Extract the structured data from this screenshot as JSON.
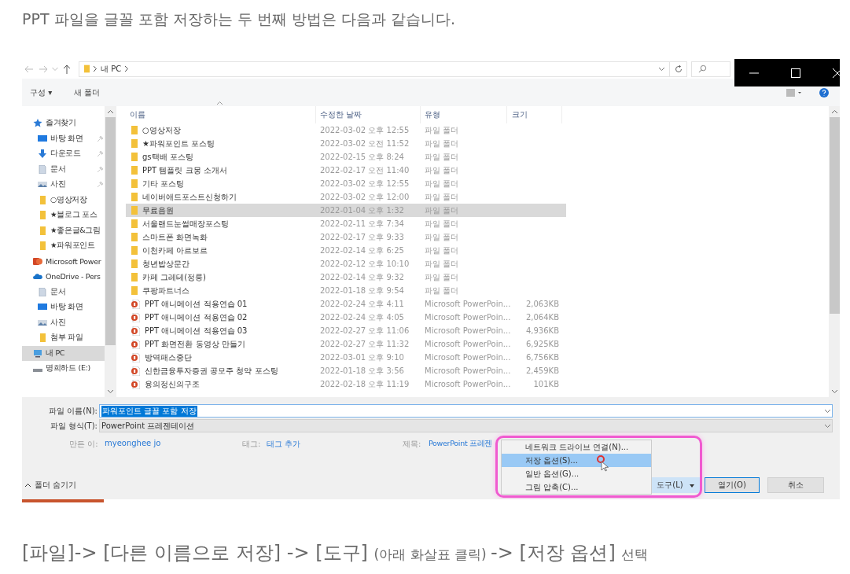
{
  "intro": "PPT 파일을 글꼴 포함 저장하는 두 번째 방법은 다음과 같습니다.",
  "dialog": {
    "path": [
      "내 PC"
    ],
    "toolbar": {
      "organize": "구성 ▾",
      "new_folder": "새 폴더"
    },
    "sidebar": [
      {
        "label": "즐겨찾기",
        "kind": "star",
        "pinned": false,
        "selected": false,
        "children": [
          {
            "label": "바탕 화면",
            "kind": "desktop",
            "pinned": true,
            "selected": false
          },
          {
            "label": "다운로드",
            "kind": "download",
            "pinned": true,
            "selected": false
          },
          {
            "label": "문서",
            "kind": "document",
            "pinned": true,
            "selected": false
          },
          {
            "label": "사진",
            "kind": "image",
            "pinned": true,
            "selected": false
          },
          {
            "label": "○영상저장",
            "kind": "folder",
            "pinned": false,
            "selected": false
          },
          {
            "label": "★블로그 포스",
            "kind": "folder",
            "pinned": false,
            "selected": false
          },
          {
            "label": "★좋은글&그림",
            "kind": "folder",
            "pinned": false,
            "selected": false
          },
          {
            "label": "★파워포인트",
            "kind": "folder",
            "pinned": false,
            "selected": false
          }
        ]
      },
      {
        "label": "Microsoft Power",
        "kind": "app",
        "pinned": false,
        "selected": false
      },
      {
        "label": "OneDrive - Pers",
        "kind": "cloud",
        "pinned": false,
        "selected": false,
        "children": [
          {
            "label": "문서",
            "kind": "document",
            "pinned": false,
            "selected": false
          },
          {
            "label": "바탕 화면",
            "kind": "desktop",
            "pinned": false,
            "selected": false
          },
          {
            "label": "사진",
            "kind": "image",
            "pinned": false,
            "selected": false
          },
          {
            "label": "첨부 파일",
            "kind": "folder",
            "pinned": false,
            "selected": false
          }
        ]
      },
      {
        "label": "내 PC",
        "kind": "pc",
        "pinned": false,
        "selected": true
      },
      {
        "label": "명희하드 (E:)",
        "kind": "drive",
        "pinned": false,
        "selected": false
      }
    ],
    "columns": [
      "이름",
      "수정한 날짜",
      "유형",
      "크기"
    ],
    "files": [
      {
        "name": "○영상저장",
        "kind": "folder",
        "date": "2022-03-02 오후 12:55",
        "type": "파일 폴더",
        "selected": false
      },
      {
        "name": "★파워포인트 포스팅",
        "kind": "folder",
        "date": "2022-03-02 오전 11:52",
        "type": "파일 폴더",
        "selected": false
      },
      {
        "name": "gs택배 포스팅",
        "kind": "folder",
        "date": "2022-02-15 오후 8:24",
        "type": "파일 폴더",
        "selected": false
      },
      {
        "name": "PPT 템플릿 크몽 소개서",
        "kind": "folder",
        "date": "2022-02-17 오전 11:40",
        "type": "파일 폴더",
        "selected": false
      },
      {
        "name": "기타 포스팅",
        "kind": "folder",
        "date": "2022-03-02 오후 12:55",
        "type": "파일 폴더",
        "selected": false
      },
      {
        "name": "네이버애드포스트신청하기",
        "kind": "folder",
        "date": "2022-03-02 오후 12:00",
        "type": "파일 폴더",
        "selected": false
      },
      {
        "name": "무료음원",
        "kind": "folder",
        "date": "2022-01-04 오후 1:32",
        "type": "파일 폴더",
        "selected": true
      },
      {
        "name": "서울랜드눈썰매장포스팅",
        "kind": "folder",
        "date": "2022-02-11 오후 7:34",
        "type": "파일 폴더",
        "selected": false
      },
      {
        "name": "스마트폰 화면녹화",
        "kind": "folder",
        "date": "2022-02-17 오후 9:33",
        "type": "파일 폴더",
        "selected": false
      },
      {
        "name": "이천카페 아르보르",
        "kind": "folder",
        "date": "2022-02-14 오후 6:25",
        "type": "파일 폴더",
        "selected": false
      },
      {
        "name": "청년밥상문간",
        "kind": "folder",
        "date": "2022-02-12 오후 10:10",
        "type": "파일 폴더",
        "selected": false
      },
      {
        "name": "카페 그레테(정릉)",
        "kind": "folder",
        "date": "2022-02-14 오후 9:32",
        "type": "파일 폴더",
        "selected": false
      },
      {
        "name": "쿠팡파트너스",
        "kind": "folder",
        "date": "2022-01-18 오후 9:54",
        "type": "파일 폴더",
        "selected": false
      },
      {
        "name": "PPT 애니메이션 적용연습 01",
        "kind": "ppt",
        "date": "2022-02-24 오후 4:11",
        "type": "Microsoft PowerPoin...",
        "size": "2,063KB",
        "selected": false
      },
      {
        "name": "PPT 애니메이션 적용연습 02",
        "kind": "ppt",
        "date": "2022-02-24 오후 4:05",
        "type": "Microsoft PowerPoin...",
        "size": "2,064KB",
        "selected": false
      },
      {
        "name": "PPT 애니메이션 적용연습 03",
        "kind": "ppt",
        "date": "2022-02-27 오후 11:06",
        "type": "Microsoft PowerPoin...",
        "size": "4,936KB",
        "selected": false
      },
      {
        "name": "PPT 화면전환 동영상 만들기",
        "kind": "ppt",
        "date": "2022-02-27 오후 11:32",
        "type": "Microsoft PowerPoin...",
        "size": "6,925KB",
        "selected": false
      },
      {
        "name": "방역패스중단",
        "kind": "ppt",
        "date": "2022-03-01 오후 9:10",
        "type": "Microsoft PowerPoin...",
        "size": "6,756KB",
        "selected": false
      },
      {
        "name": "신한금융투자증권 공모주 청약 포스팅",
        "kind": "ppt",
        "date": "2022-01-18 오후 3:56",
        "type": "Microsoft PowerPoin...",
        "size": "2,459KB",
        "selected": false
      },
      {
        "name": "융의정신의구조",
        "kind": "ppt",
        "date": "2022-02-18 오후 11:19",
        "type": "Microsoft PowerPoin...",
        "size": "101KB",
        "selected": false
      }
    ],
    "file_name": {
      "label": "파일 이름(N):",
      "value": "파워포인트 글꼴 포함 저장"
    },
    "file_type": {
      "label": "파일 형식(T):",
      "value": "PowerPoint 프레젠테이션"
    },
    "meta": [
      {
        "label": "만든 이:",
        "value": "myeonghee jo"
      },
      {
        "label": "태그:",
        "value": "태그 추가"
      },
      {
        "label": "제목:",
        "value": "PowerPoint 프레젠"
      }
    ],
    "hide_folders": "폴더 숨기기",
    "tools_button": "도구(L)",
    "open_button": "열기(O)",
    "cancel_button": "취소",
    "tools_menu": [
      {
        "label": "네트워크 드라이브 연결(N)...",
        "selected": false
      },
      {
        "label": "저장 옵션(S)...",
        "selected": true
      },
      {
        "label": "일반 옵션(G)...",
        "selected": false
      },
      {
        "label": "그림 압축(C)...",
        "selected": false
      }
    ]
  },
  "caption": [
    {
      "text": "[파일]-> [다른 이름으로 저장] -> [도구] ",
      "kind": "big"
    },
    {
      "text": "(아래 화살표 클릭) ",
      "kind": "small"
    },
    {
      "text": "-> [저장 옵션] ",
      "kind": "big"
    },
    {
      "text": "선택",
      "kind": "small"
    }
  ]
}
